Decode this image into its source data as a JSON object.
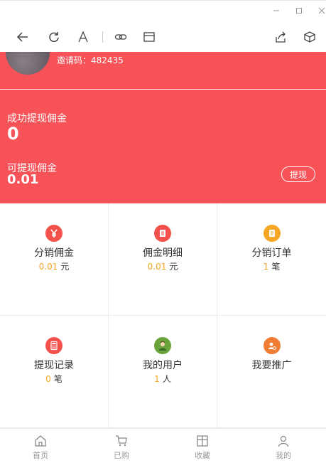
{
  "window": {
    "controls": [
      "minimize",
      "maximize",
      "close"
    ]
  },
  "toolbar": {
    "buttons": [
      "back",
      "refresh",
      "text-size",
      "link",
      "window",
      "share",
      "cube"
    ]
  },
  "profile": {
    "invite_text": "邀请码：482435"
  },
  "stats": {
    "success_label": "成功提现佣金",
    "success_value": "0",
    "available_label": "可提现佣金",
    "available_value": "0.01",
    "withdraw_button": "提现"
  },
  "grid": {
    "items": [
      {
        "title": "分销佣金",
        "num": "0.01",
        "unit": "元",
        "icon": "yuan-icon",
        "color": "#f2514c"
      },
      {
        "title": "佣金明细",
        "num": "0.01",
        "unit": "元",
        "icon": "detail-icon",
        "color": "#f2514c"
      },
      {
        "title": "分销订单",
        "num": "1",
        "unit": "笔",
        "icon": "order-icon",
        "color": "#f5a623"
      },
      {
        "title": "提现记录",
        "num": "0",
        "unit": "笔",
        "icon": "calculator-icon",
        "color": "#f2514c"
      },
      {
        "title": "我的用户",
        "num": "1",
        "unit": "人",
        "icon": "user-avatar-icon",
        "color": "#6aa33a"
      },
      {
        "title": "我要推广",
        "num": "",
        "unit": "",
        "icon": "promote-icon",
        "color": "#f07d33"
      }
    ]
  },
  "tabbar": {
    "tabs": [
      {
        "label": "首页",
        "icon": "home-icon"
      },
      {
        "label": "已购",
        "icon": "cart-icon"
      },
      {
        "label": "收藏",
        "icon": "favorite-box-icon"
      },
      {
        "label": "我的",
        "icon": "profile-icon"
      }
    ]
  },
  "colors": {
    "hero_bg": "#f75257",
    "accent_number": "#f5a623"
  }
}
